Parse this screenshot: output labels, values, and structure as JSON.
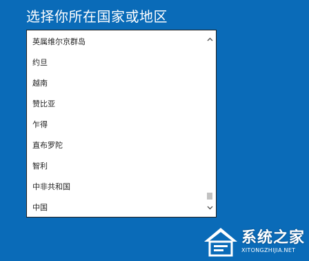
{
  "page": {
    "title": "选择你所在国家或地区"
  },
  "country_list": {
    "items": [
      {
        "label": "英属维尔京群岛"
      },
      {
        "label": "约旦"
      },
      {
        "label": "越南"
      },
      {
        "label": "赞比亚"
      },
      {
        "label": "乍得"
      },
      {
        "label": "直布罗陀"
      },
      {
        "label": "智利"
      },
      {
        "label": "中非共和国"
      },
      {
        "label": "中国"
      }
    ],
    "scroll_position": 0.97
  },
  "watermark": {
    "title": "系统之家",
    "url": "XITONGZHIJIA.NET"
  },
  "colors": {
    "background": "#0a6bb8",
    "list_background": "#ffffff",
    "text": "#222222",
    "scroll_thumb": "#c2c2c2"
  },
  "icons": {
    "scroll_up": "chevron-up-icon",
    "scroll_down": "chevron-down-icon",
    "watermark_logo": "house-logo-icon"
  }
}
